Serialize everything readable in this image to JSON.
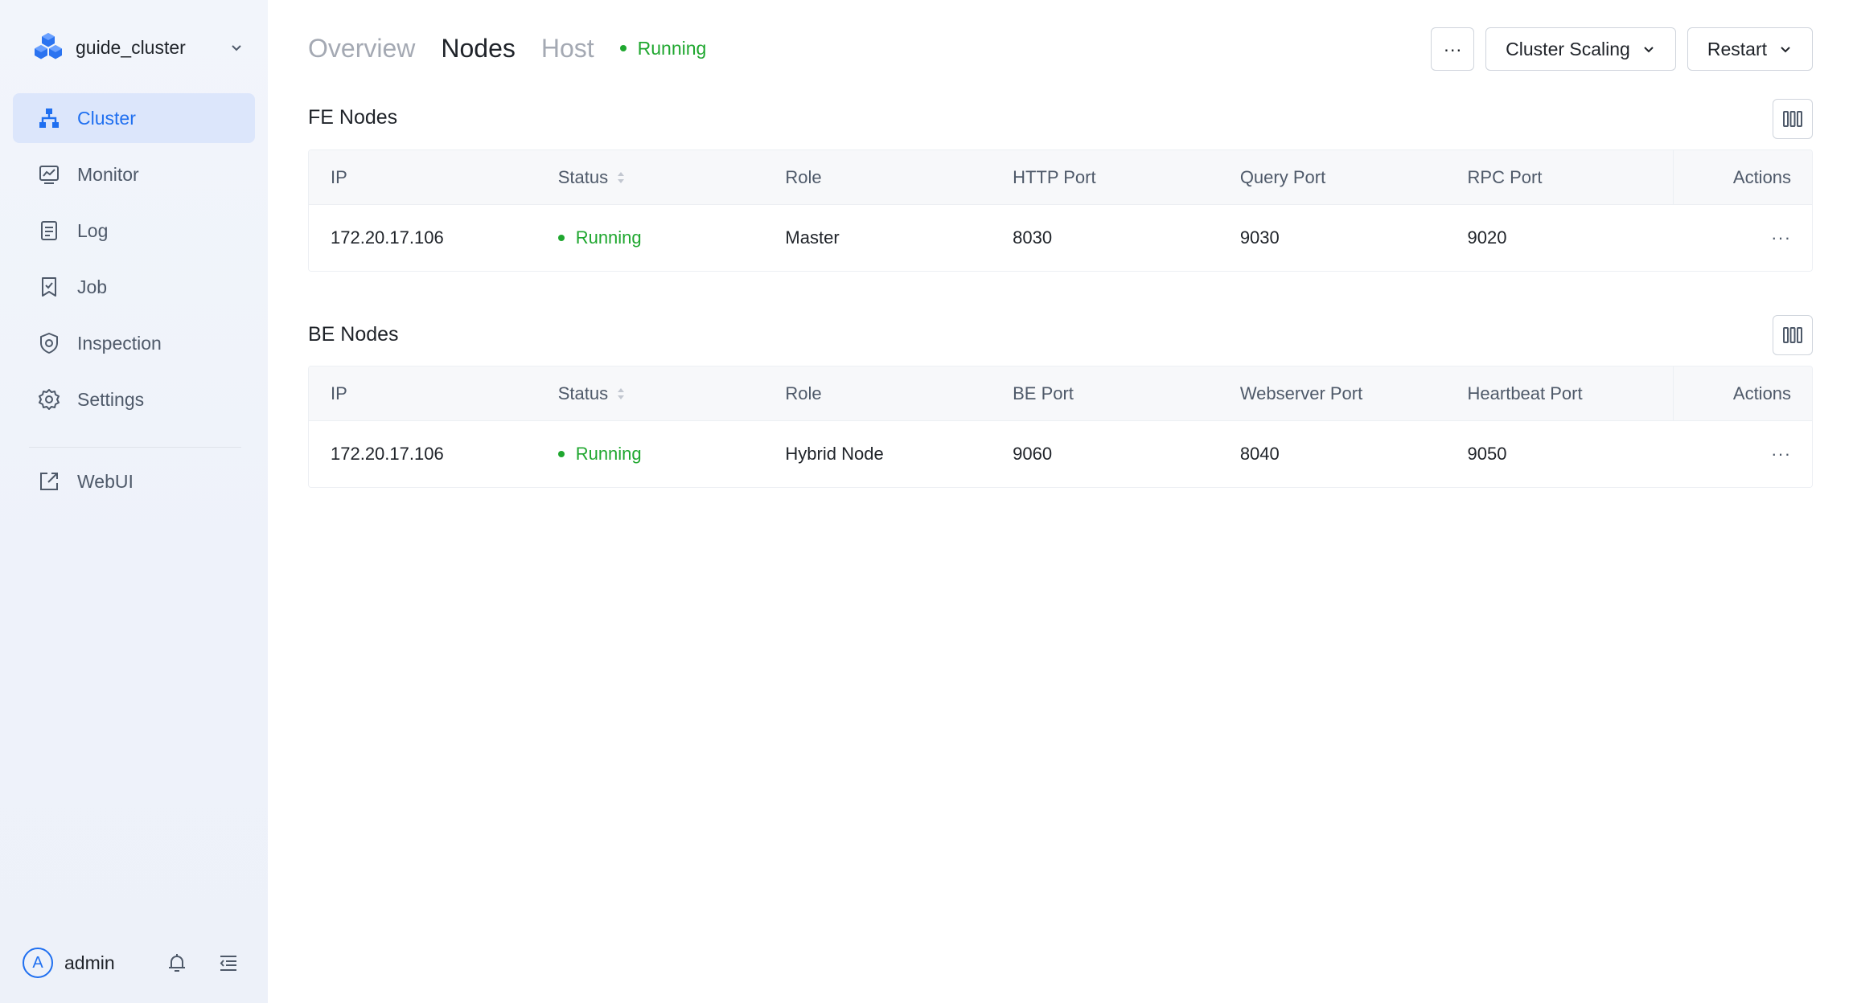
{
  "sidebar": {
    "cluster_name": "guide_cluster",
    "nav": [
      {
        "label": "Cluster",
        "icon": "cluster-icon",
        "active": true
      },
      {
        "label": "Monitor",
        "icon": "monitor-icon",
        "active": false
      },
      {
        "label": "Log",
        "icon": "log-icon",
        "active": false
      },
      {
        "label": "Job",
        "icon": "job-icon",
        "active": false
      },
      {
        "label": "Inspection",
        "icon": "inspection-icon",
        "active": false
      },
      {
        "label": "Settings",
        "icon": "gear-icon",
        "active": false
      }
    ],
    "webui_label": "WebUI",
    "user": {
      "avatar_letter": "A",
      "name": "admin"
    }
  },
  "header": {
    "tabs": [
      {
        "label": "Overview",
        "active": false
      },
      {
        "label": "Nodes",
        "active": true
      },
      {
        "label": "Host",
        "active": false
      }
    ],
    "status": "Running",
    "more_label": "···",
    "cluster_scaling_label": "Cluster Scaling",
    "restart_label": "Restart"
  },
  "fe": {
    "title": "FE Nodes",
    "columns": [
      "IP",
      "Status",
      "Role",
      "HTTP Port",
      "Query Port",
      "RPC Port",
      "Actions"
    ],
    "rows": [
      {
        "ip": "172.20.17.106",
        "status": "Running",
        "role": "Master",
        "p1": "8030",
        "p2": "9030",
        "p3": "9020",
        "actions": "···"
      }
    ]
  },
  "be": {
    "title": "BE Nodes",
    "columns": [
      "IP",
      "Status",
      "Role",
      "BE Port",
      "Webserver Port",
      "Heartbeat Port",
      "Actions"
    ],
    "rows": [
      {
        "ip": "172.20.17.106",
        "status": "Running",
        "role": "Hybrid Node",
        "p1": "9060",
        "p2": "8040",
        "p3": "9050",
        "actions": "···"
      }
    ]
  },
  "colors": {
    "accent": "#1f6ff0",
    "running": "#1fa72f",
    "active_nav_bg": "#dce6fb"
  }
}
